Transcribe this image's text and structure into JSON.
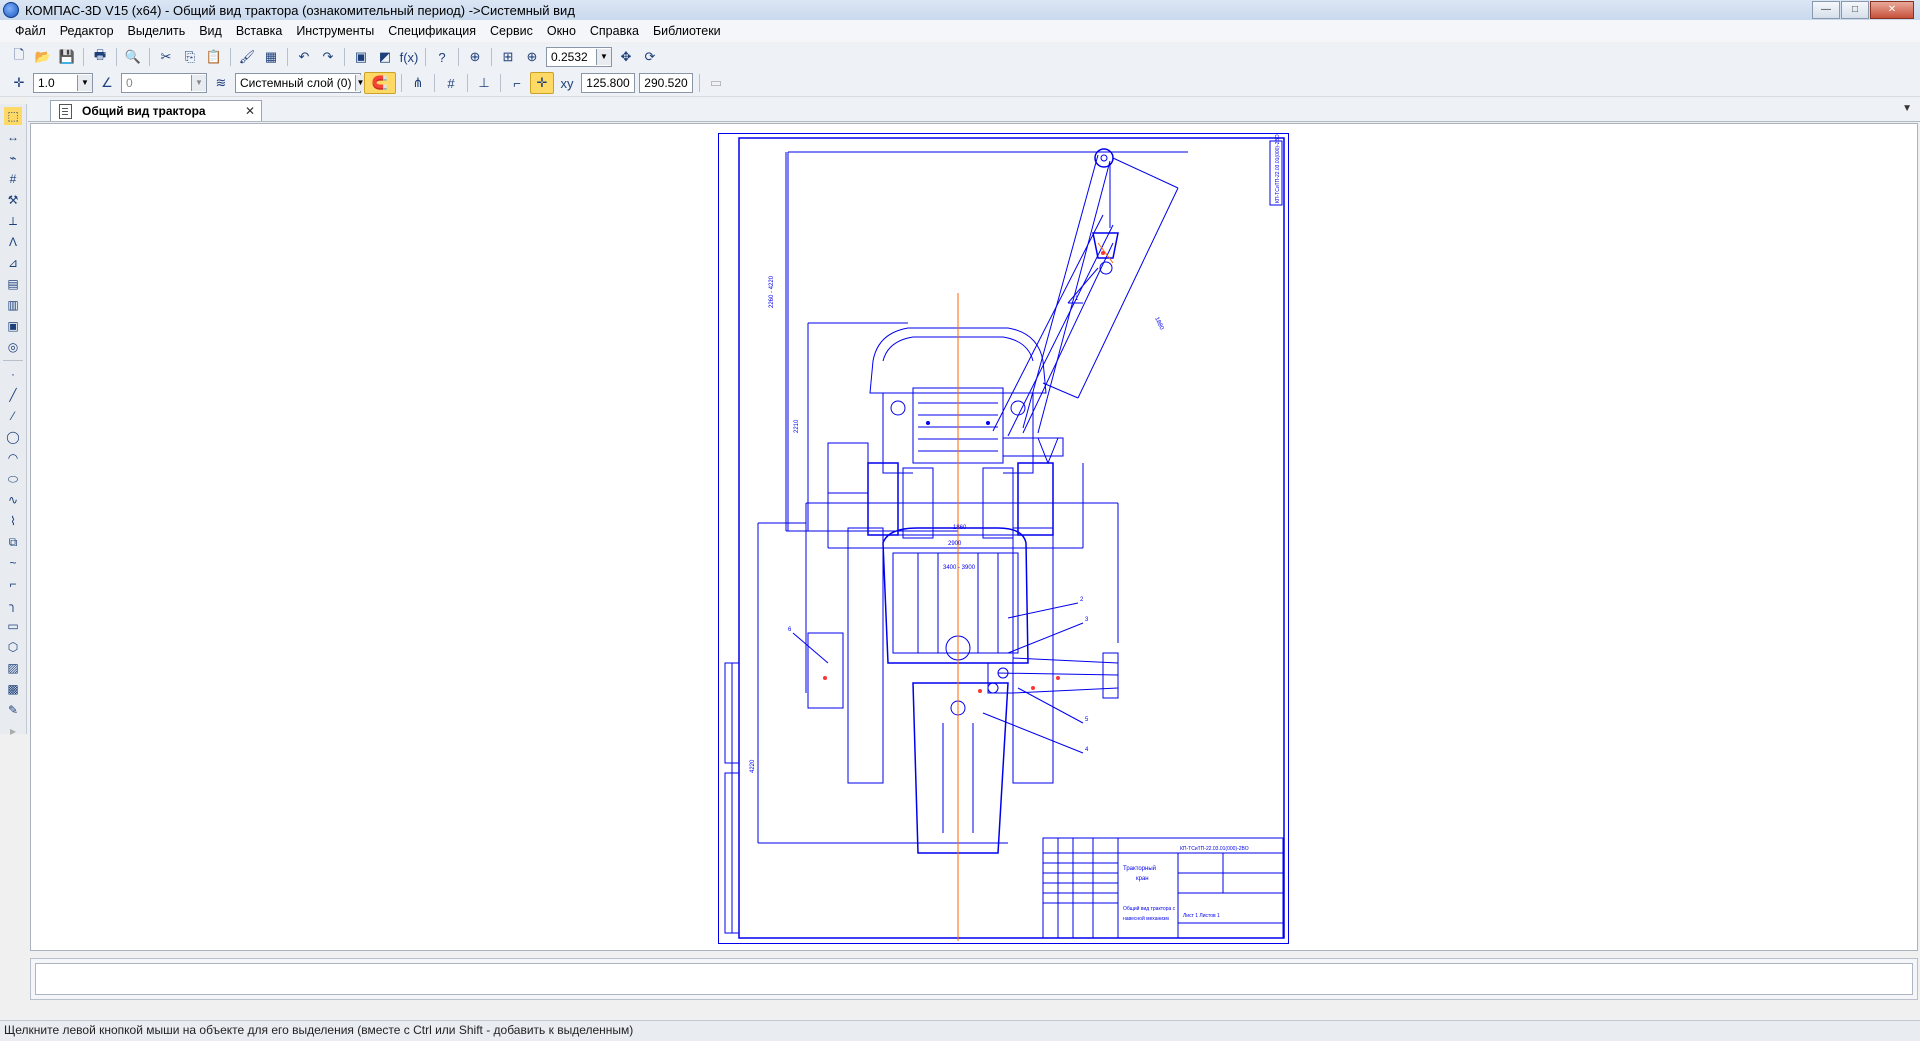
{
  "window": {
    "title": "КОМПАС-3D V15 (x64) - Общий вид трактора (ознакомительный период) ->Системный вид",
    "minimize": "—",
    "maximize": "□",
    "close": "✕"
  },
  "menu": [
    "Файл",
    "Редактор",
    "Выделить",
    "Вид",
    "Вставка",
    "Инструменты",
    "Спецификация",
    "Сервис",
    "Окно",
    "Справка",
    "Библиотеки"
  ],
  "toolbar1": {
    "zoom_value": "0.2532"
  },
  "toolbar2": {
    "step_value": "1.0",
    "angle_value": "0",
    "layer_value": "Системный слой (0)",
    "coord_x": "125.800",
    "coord_y": "290.520"
  },
  "document_tab": {
    "title": "Общий вид трактора",
    "close": "✕"
  },
  "drawing": {
    "dim_2260_4220": "2260 - 4220",
    "dim_2210": "2210",
    "dim_1860": "1860",
    "dim_2900": "2900",
    "dim_3400_3900": "3400 - 3900",
    "dim_4220": "4220",
    "dim_1880": "1880",
    "stamp_code": "КП-ТСиТП-22.03.01(000)-2ВО",
    "stamp_name_1": "Тракторный",
    "stamp_name_2": "кран",
    "stamp_doc": "Общий вид трактора с",
    "stamp_doc2": "навесной механизм",
    "sheet": "Лист 1 Листов 1",
    "leader_1": "1",
    "leader_2": "2",
    "leader_3": "3",
    "leader_4": "4",
    "leader_5": "5",
    "leader_6": "6"
  },
  "status_text": "Щелкните левой кнопкой мыши на объекте для его выделения (вместе с Ctrl или Shift - добавить к выделенным)",
  "colors": {
    "drawing_line": "#0000ee",
    "axis_line": "#ff6a00",
    "accent_yellow": "#ffd966"
  }
}
